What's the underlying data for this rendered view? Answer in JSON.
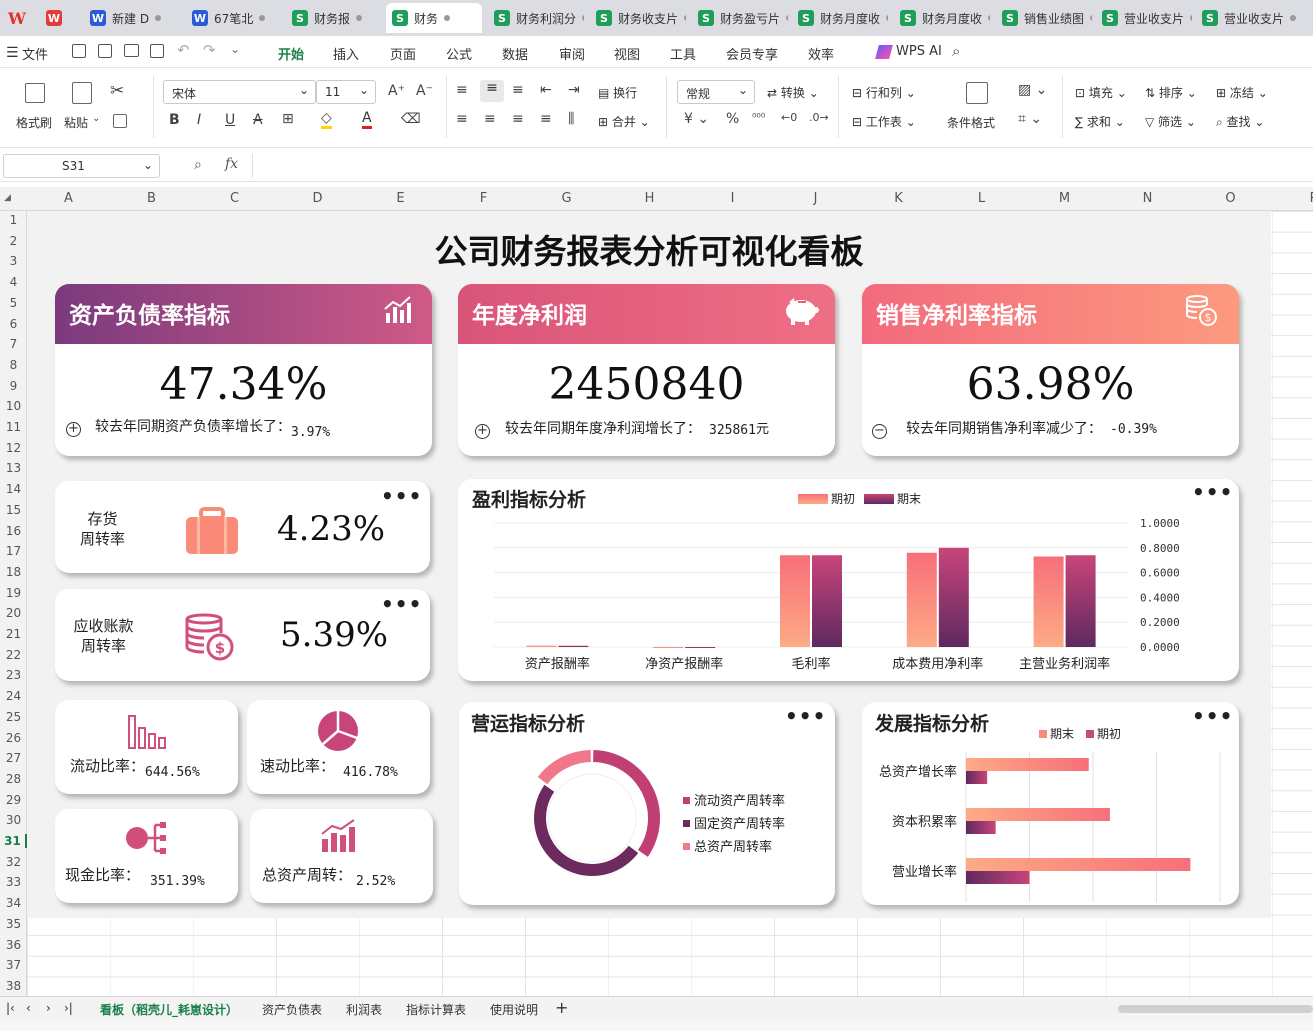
{
  "tabs": [
    {
      "icon": "W",
      "type": "p",
      "label": ""
    },
    {
      "icon": "W",
      "type": "w",
      "label": "新建 D"
    },
    {
      "icon": "W",
      "type": "w",
      "label": "67笔北"
    },
    {
      "icon": "S",
      "type": "s",
      "label": "财务报"
    },
    {
      "icon": "S",
      "type": "s",
      "label": "财务"
    },
    {
      "icon": "S",
      "type": "s",
      "label": "财务利润分"
    },
    {
      "icon": "S",
      "type": "s",
      "label": "财务收支片"
    },
    {
      "icon": "S",
      "type": "s",
      "label": "财务盈亏片"
    },
    {
      "icon": "S",
      "type": "s",
      "label": "财务月度收"
    },
    {
      "icon": "S",
      "type": "s",
      "label": "财务月度收"
    },
    {
      "icon": "S",
      "type": "s",
      "label": "销售业绩图"
    },
    {
      "icon": "S",
      "type": "s",
      "label": "营业收支片"
    },
    {
      "icon": "S",
      "type": "s",
      "label": "营业收支片"
    }
  ],
  "menu": {
    "file": "文件",
    "items": [
      "开始",
      "插入",
      "页面",
      "公式",
      "数据",
      "审阅",
      "视图",
      "工具",
      "会员专享",
      "效率"
    ],
    "wps_ai": "WPS AI"
  },
  "ribbon": {
    "format_painter": "格式刷",
    "paste": "粘贴",
    "font_name": "宋体",
    "font_size": "11",
    "wrap": "换行",
    "merge": "合并",
    "number_format": "常规",
    "convert": "转换",
    "row_col": "行和列",
    "worksheet": "工作表",
    "cond_format": "条件格式",
    "fill": "填充",
    "sort": "排序",
    "freeze": "冻结",
    "sum": "求和",
    "filter": "筛选",
    "find": "查找"
  },
  "formula_bar": {
    "cell_ref": "S31",
    "fx": "fx",
    "value": ""
  },
  "columns": [
    "A",
    "B",
    "C",
    "D",
    "E",
    "F",
    "G",
    "H",
    "I",
    "J",
    "K",
    "L",
    "M",
    "N",
    "O",
    "P"
  ],
  "rows": [
    "1",
    "2",
    "3",
    "4",
    "5",
    "6",
    "7",
    "8",
    "9",
    "10",
    "11",
    "12",
    "13",
    "14",
    "15",
    "16",
    "17",
    "18",
    "19",
    "20",
    "21",
    "22",
    "23",
    "24",
    "25",
    "26",
    "27",
    "28",
    "29",
    "30",
    "31",
    "32",
    "33",
    "34",
    "35",
    "36",
    "37",
    "38"
  ],
  "dashboard": {
    "title": "公司财务报表分析可视化看板",
    "kpi": [
      {
        "title": "资产负债率指标",
        "value": "47.34%",
        "sign": "+",
        "note": "较去年同期资产负债率增长了：",
        "delta": "3.97%",
        "unit": "",
        "grad_from": "#7b3a7e",
        "grad_to": "#cf5a86"
      },
      {
        "title": "年度净利润",
        "value": "2450840",
        "sign": "+",
        "note": "较去年同期年度净利润增长了：",
        "delta": "325861",
        "unit": "元",
        "grad_from": "#d9547a",
        "grad_to": "#ef6f84"
      },
      {
        "title": "销售净利率指标",
        "value": "63.98%",
        "sign": "−",
        "note": "较去年同期销售净利率减少了：",
        "delta": "-0.39%",
        "unit": "",
        "grad_from": "#f26a7d",
        "grad_to": "#fd9a7e"
      }
    ],
    "turnover": [
      {
        "label_l1": "存货",
        "label_l2": "周转率",
        "value": "4.23%"
      },
      {
        "label_l1": "应收账款",
        "label_l2": "周转率",
        "value": "5.39%"
      }
    ],
    "ratios": [
      {
        "label": "流动比率：",
        "value": "644.56%"
      },
      {
        "label": "速动比率：",
        "value": "416.78%"
      },
      {
        "label": "现金比率：",
        "value": "351.39%"
      },
      {
        "label": "总资产周转：",
        "value": "2.52%"
      }
    ],
    "more": "•••",
    "colors": {
      "light": "#f98b78",
      "dark": "#7a2f63",
      "mid": "#c44a7c",
      "pink": "#e2577c"
    }
  },
  "chart_data": [
    {
      "type": "bar",
      "title": "盈利指标分析",
      "categories": [
        "资产报酬率",
        "净资产报酬率",
        "毛利率",
        "成本费用净利率",
        "主营业务利润率"
      ],
      "series": [
        {
          "name": "期初",
          "values": [
            0.01,
            0.0,
            0.74,
            0.76,
            0.73
          ]
        },
        {
          "name": "期末",
          "values": [
            0.01,
            0.0,
            0.74,
            0.8,
            0.74
          ]
        }
      ],
      "ylim": [
        0,
        1
      ],
      "yticks": [
        "1.0000",
        "0.8000",
        "0.6000",
        "0.4000",
        "0.2000",
        "0.0000"
      ],
      "legend": "top-center"
    },
    {
      "type": "pie",
      "title": "营运指标分析",
      "categories": [
        "流动资产周转率",
        "固定资产周转率",
        "总资产周转率"
      ],
      "values": [
        35,
        50,
        15
      ],
      "legend": "right"
    },
    {
      "type": "bar",
      "orientation": "horizontal",
      "title": "发展指标分析",
      "categories": [
        "总资产增长率",
        "资本积累率",
        "营业增长率"
      ],
      "series": [
        {
          "name": "期末",
          "values": [
            0.29,
            0.34,
            0.53
          ]
        },
        {
          "name": "期初",
          "values": [
            0.05,
            0.07,
            0.15
          ]
        }
      ],
      "legend": "top-center"
    }
  ],
  "sheets": [
    "看板（稻壳儿_耗崽设计）",
    "资产负债表",
    "利润表",
    "指标计算表",
    "使用说明"
  ],
  "add_sheet": "+"
}
